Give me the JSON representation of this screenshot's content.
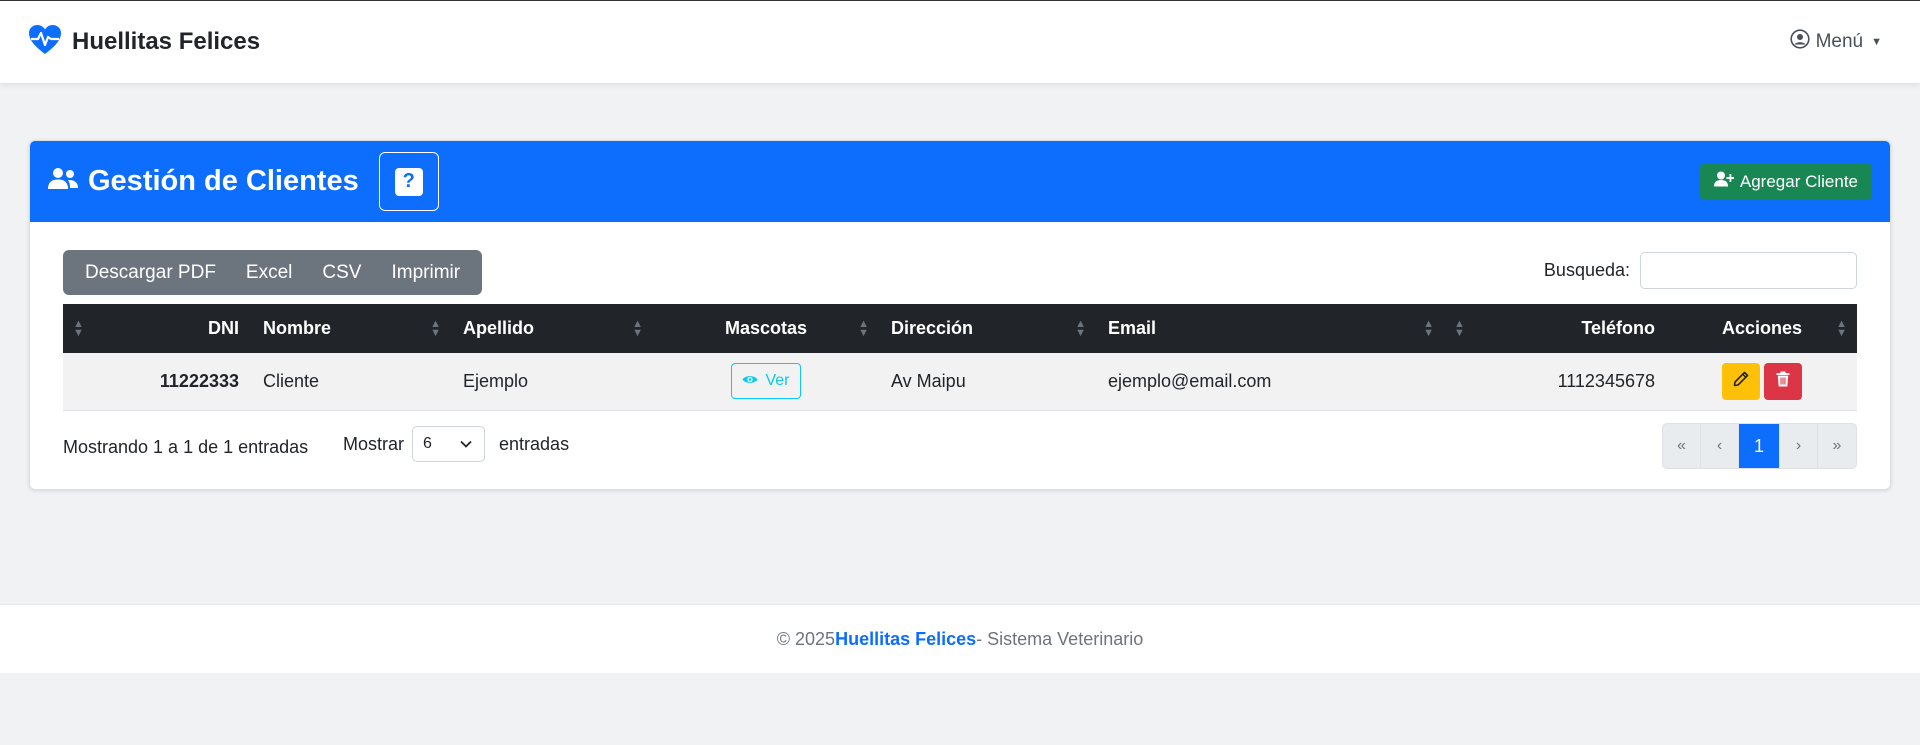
{
  "navbar": {
    "brand": "Huellitas Felices",
    "brand_icon": "heart-pulse-icon",
    "menu_label": "Menú",
    "menu_icon": "user-circle-icon"
  },
  "card": {
    "title": "Gestión de Clientes",
    "help_label": "?",
    "add_button": "Agregar Cliente"
  },
  "toolbar": {
    "buttons": [
      "Descargar PDF",
      "Excel",
      "CSV",
      "Imprimir"
    ],
    "search_label": "Busqueda:",
    "search_value": ""
  },
  "table": {
    "columns": [
      "DNI",
      "Nombre",
      "Apellido",
      "Mascotas",
      "Dirección",
      "Email",
      "Teléfono",
      "Acciones"
    ],
    "rows": [
      {
        "dni": "11222333",
        "nombre": "Cliente",
        "apellido": "Ejemplo",
        "mascotas_button": "Ver",
        "direccion": "Av Maipu",
        "email": "ejemplo@email.com",
        "telefono": "1112345678"
      }
    ]
  },
  "table_footer": {
    "info": "Mostrando 1 a 1 de 1 entradas",
    "show_label": "Mostrar",
    "page_size": "6",
    "entries_label": "entradas",
    "pagination": [
      "«",
      "‹",
      "1",
      "›",
      "»"
    ],
    "current_page": "1"
  },
  "footer": {
    "prefix": "© 2025",
    "brand": "Huellitas Felices",
    "suffix": " - Sistema Veterinario"
  },
  "colors": {
    "primary": "#0d6efd",
    "success": "#198754",
    "warning": "#ffc107",
    "danger": "#dc3545",
    "info": "#0dcaf0",
    "dark": "#212529",
    "secondary": "#6c757d"
  }
}
